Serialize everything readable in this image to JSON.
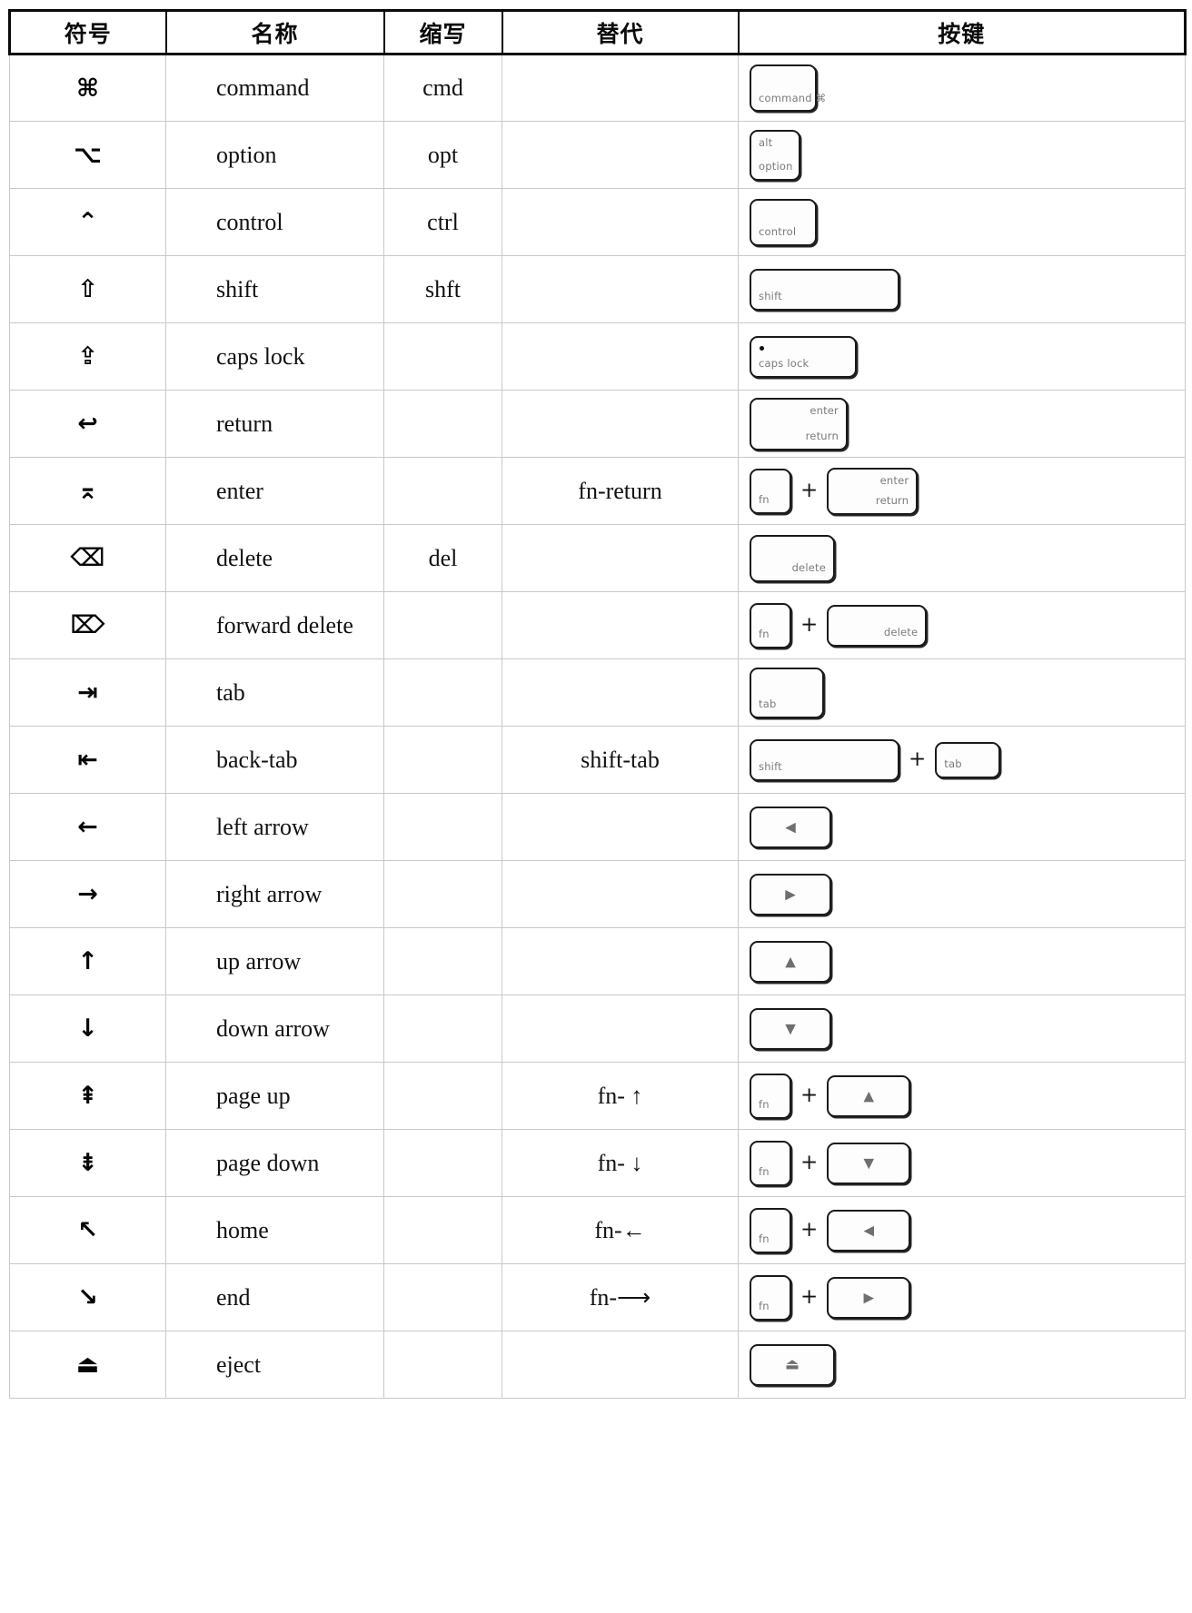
{
  "table": {
    "headers": [
      "符号",
      "名称",
      "缩写",
      "替代",
      "按键"
    ],
    "rows": [
      {
        "symbol": "⌘",
        "symbol_name": "command-symbol",
        "name": "command",
        "abbr": "cmd",
        "alt": "",
        "keys": [
          {
            "shape": "s-std",
            "labels": [
              {
                "pos": "bl",
                "text": "command  ⌘"
              }
            ]
          }
        ]
      },
      {
        "symbol": "⌥",
        "symbol_name": "option-symbol",
        "name": "option",
        "abbr": "opt",
        "alt": "",
        "keys": [
          {
            "shape": "s-sq",
            "labels": [
              {
                "pos": "tl",
                "text": "alt"
              },
              {
                "pos": "bl",
                "text": "option"
              }
            ]
          }
        ]
      },
      {
        "symbol": "⌃",
        "symbol_name": "control-symbol",
        "name": "control",
        "abbr": "ctrl",
        "alt": "",
        "keys": [
          {
            "shape": "s-std",
            "labels": [
              {
                "pos": "bl",
                "text": "control"
              }
            ]
          }
        ]
      },
      {
        "symbol": "⇧",
        "symbol_name": "shift-symbol",
        "name": "shift",
        "abbr": "shft",
        "alt": "",
        "keys": [
          {
            "shape": "s-shift",
            "labels": [
              {
                "pos": "bl",
                "text": "shift"
              }
            ]
          }
        ]
      },
      {
        "symbol": "⇪",
        "symbol_name": "caps-lock-symbol",
        "name": "caps lock",
        "abbr": "",
        "alt": "",
        "keys": [
          {
            "shape": "s-caps",
            "dot": true,
            "labels": [
              {
                "pos": "bl",
                "text": "caps lock"
              }
            ]
          }
        ]
      },
      {
        "symbol": "↩",
        "symbol_name": "return-symbol",
        "name": "return",
        "abbr": "",
        "alt": "",
        "keys": [
          {
            "shape": "s-ret",
            "labels": [
              {
                "pos": "tr",
                "text": "enter"
              },
              {
                "pos": "br",
                "text": "return"
              }
            ]
          }
        ]
      },
      {
        "symbol": "⌅",
        "symbol_name": "enter-symbol",
        "name": "enter",
        "abbr": "",
        "alt": "fn-return",
        "keys": [
          {
            "shape": "s-fn",
            "labels": [
              {
                "pos": "bl",
                "text": "fn"
              }
            ]
          },
          {
            "plus": true
          },
          {
            "shape": "s-retb",
            "labels": [
              {
                "pos": "tr",
                "text": "enter"
              },
              {
                "pos": "br",
                "text": "return"
              }
            ]
          }
        ]
      },
      {
        "symbol": "⌫",
        "symbol_name": "delete-symbol",
        "name": "delete",
        "abbr": "del",
        "alt": "",
        "keys": [
          {
            "shape": "s-del",
            "labels": [
              {
                "pos": "br",
                "text": "delete"
              }
            ]
          }
        ]
      },
      {
        "symbol": "⌦",
        "symbol_name": "forward-delete-symbol",
        "name": "forward delete",
        "abbr": "",
        "alt": "",
        "keys": [
          {
            "shape": "s-fn",
            "labels": [
              {
                "pos": "bl",
                "text": "fn"
              }
            ]
          },
          {
            "plus": true
          },
          {
            "shape": "s-delb",
            "labels": [
              {
                "pos": "br",
                "text": "delete"
              }
            ]
          }
        ]
      },
      {
        "symbol": "⇥",
        "symbol_name": "tab-symbol",
        "name": "tab",
        "abbr": "",
        "alt": "",
        "keys": [
          {
            "shape": "s-tab",
            "labels": [
              {
                "pos": "bl",
                "text": "tab"
              }
            ]
          }
        ]
      },
      {
        "symbol": "⇤",
        "symbol_name": "back-tab-symbol",
        "name": "back-tab",
        "abbr": "",
        "alt": "shift-tab",
        "keys": [
          {
            "shape": "s-shift",
            "labels": [
              {
                "pos": "bl",
                "text": "shift"
              }
            ]
          },
          {
            "plus": true
          },
          {
            "shape": "s-tabs",
            "labels": [
              {
                "pos": "bl",
                "text": "tab"
              }
            ]
          }
        ]
      },
      {
        "symbol": "←",
        "symbol_name": "left-arrow-symbol",
        "name": "left arrow",
        "abbr": "",
        "alt": "",
        "keys": [
          {
            "shape": "s-arrow",
            "tri": "◀"
          }
        ]
      },
      {
        "symbol": "→",
        "symbol_name": "right-arrow-symbol",
        "name": "right arrow",
        "abbr": "",
        "alt": "",
        "keys": [
          {
            "shape": "s-arrow",
            "tri": "▶"
          }
        ]
      },
      {
        "symbol": "↑",
        "symbol_name": "up-arrow-symbol",
        "name": "up arrow",
        "abbr": "",
        "alt": "",
        "keys": [
          {
            "shape": "s-arrow",
            "tri": "▲"
          }
        ]
      },
      {
        "symbol": "↓",
        "symbol_name": "down-arrow-symbol",
        "name": "down arrow",
        "abbr": "",
        "alt": "",
        "keys": [
          {
            "shape": "s-arrow",
            "tri": "▼"
          }
        ]
      },
      {
        "symbol": "⇞",
        "symbol_name": "page-up-symbol",
        "name": "page up",
        "abbr": "",
        "alt": "fn- ↑",
        "keys": [
          {
            "shape": "s-fn",
            "labels": [
              {
                "pos": "bl",
                "text": "fn"
              }
            ]
          },
          {
            "plus": true
          },
          {
            "shape": "s-arrowb",
            "tri": "▲"
          }
        ]
      },
      {
        "symbol": "⇟",
        "symbol_name": "page-down-symbol",
        "name": "page down",
        "abbr": "",
        "alt": "fn- ↓",
        "keys": [
          {
            "shape": "s-fn",
            "labels": [
              {
                "pos": "bl",
                "text": "fn"
              }
            ]
          },
          {
            "plus": true
          },
          {
            "shape": "s-arrowb",
            "tri": "▼"
          }
        ]
      },
      {
        "symbol": "↖",
        "symbol_name": "home-symbol",
        "name": "home",
        "abbr": "",
        "alt": "fn-←",
        "keys": [
          {
            "shape": "s-fn",
            "labels": [
              {
                "pos": "bl",
                "text": "fn"
              }
            ]
          },
          {
            "plus": true
          },
          {
            "shape": "s-arrowb",
            "tri": "◀"
          }
        ]
      },
      {
        "symbol": "↘",
        "symbol_name": "end-symbol",
        "name": "end",
        "abbr": "",
        "alt": "fn-⟶",
        "keys": [
          {
            "shape": "s-fn",
            "labels": [
              {
                "pos": "bl",
                "text": "fn"
              }
            ]
          },
          {
            "plus": true
          },
          {
            "shape": "s-arrowb",
            "tri": "▶"
          }
        ]
      },
      {
        "symbol": "⏏",
        "symbol_name": "eject-symbol",
        "name": "eject",
        "abbr": "",
        "alt": "",
        "keys": [
          {
            "shape": "s-eject",
            "eject": "⏏"
          }
        ]
      }
    ],
    "plus_glyph": "+"
  }
}
